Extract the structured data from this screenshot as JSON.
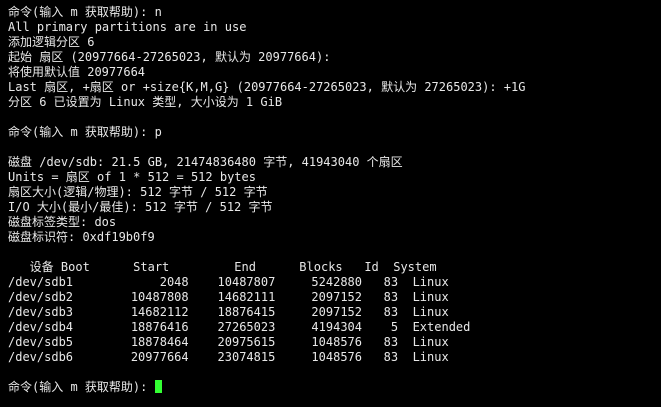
{
  "terminal": {
    "lines": [
      "命令(输入 m 获取帮助): n",
      "All primary partitions are in use",
      "添加逻辑分区 6",
      "起始 扇区 (20977664-27265023, 默认为 20977664):",
      "将使用默认值 20977664",
      "Last 扇区, +扇区 or +size{K,M,G} (20977664-27265023, 默认为 27265023): +1G",
      "分区 6 已设置为 Linux 类型, 大小设为 1 GiB",
      "",
      "命令(输入 m 获取帮助): p",
      "",
      "磁盘 /dev/sdb: 21.5 GB, 21474836480 字节, 41943040 个扇区",
      "Units = 扇区 of 1 * 512 = 512 bytes",
      "扇区大小(逻辑/物理): 512 字节 / 512 字节",
      "I/O 大小(最小/最佳): 512 字节 / 512 字节",
      "磁盘标签类型: dos",
      "磁盘标识符: 0xdf19b0f9",
      ""
    ],
    "table_header": "   设备 Boot      Start         End      Blocks   Id  System",
    "table_rows": [
      "/dev/sdb1            2048    10487807     5242880   83  Linux",
      "/dev/sdb2        10487808    14682111     2097152   83  Linux",
      "/dev/sdb3        14682112    18876415     2097152   83  Linux",
      "/dev/sdb4        18876416    27265023     4194304    5  Extended",
      "/dev/sdb5        18878464    20975615     1048576   83  Linux",
      "/dev/sdb6        20977664    23074815     1048576   83  Linux"
    ],
    "prompt": "命令(输入 m 获取帮助): ",
    "cursor_color": "#33ff33",
    "text_color": "#e8e8e8",
    "background_color": "#000000"
  }
}
